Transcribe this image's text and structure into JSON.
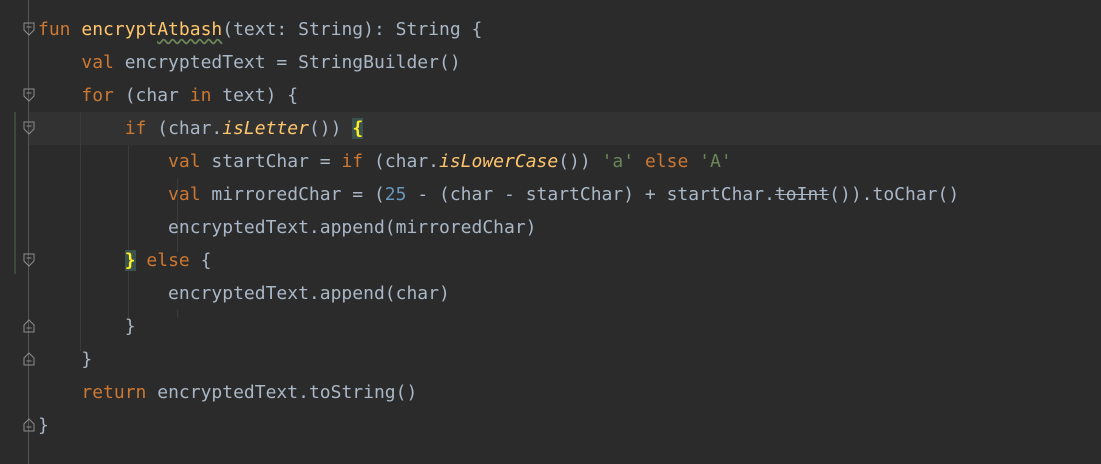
{
  "code": {
    "lines": [
      [
        {
          "t": "fun",
          "c": "kw"
        },
        {
          "t": " "
        },
        {
          "t": "encrypt",
          "c": "fn"
        },
        {
          "t": "Atbash",
          "c": "fn wavy"
        },
        {
          "t": "(text: String): String {"
        }
      ],
      [
        {
          "t": "    "
        },
        {
          "t": "val",
          "c": "kw"
        },
        {
          "t": " encryptedText = StringBuilder()"
        }
      ],
      [
        {
          "t": "    "
        },
        {
          "t": "for",
          "c": "kw"
        },
        {
          "t": " (char "
        },
        {
          "t": "in",
          "c": "kw"
        },
        {
          "t": " text) {"
        }
      ],
      [
        {
          "t": "        "
        },
        {
          "t": "if",
          "c": "kw"
        },
        {
          "t": " (char."
        },
        {
          "t": "isLetter",
          "c": "it"
        },
        {
          "t": "()) "
        },
        {
          "t": "{",
          "c": "brace-hl"
        }
      ],
      [
        {
          "t": "            "
        },
        {
          "t": "val",
          "c": "kw"
        },
        {
          "t": " startChar = "
        },
        {
          "t": "if",
          "c": "kw"
        },
        {
          "t": " (char."
        },
        {
          "t": "isLowerCase",
          "c": "it"
        },
        {
          "t": "()) "
        },
        {
          "t": "'a'",
          "c": "str"
        },
        {
          "t": " "
        },
        {
          "t": "else",
          "c": "kw"
        },
        {
          "t": " "
        },
        {
          "t": "'A'",
          "c": "str"
        }
      ],
      [
        {
          "t": "            "
        },
        {
          "t": "val",
          "c": "kw"
        },
        {
          "t": " mirroredChar = ("
        },
        {
          "t": "25",
          "c": "num"
        },
        {
          "t": " - (char - startChar) + startChar."
        },
        {
          "t": "toInt",
          "c": "strike"
        },
        {
          "t": "()).toChar()"
        }
      ],
      [
        {
          "t": "            encryptedText.append(mirroredChar)"
        }
      ],
      [
        {
          "t": "        "
        },
        {
          "t": "}",
          "c": "brace-hl"
        },
        {
          "t": " "
        },
        {
          "t": "else",
          "c": "kw"
        },
        {
          "t": " {"
        }
      ],
      [
        {
          "t": "            encryptedText.append(char)"
        }
      ],
      [
        {
          "t": "        }"
        }
      ],
      [
        {
          "t": "    }"
        }
      ],
      [
        {
          "t": "    "
        },
        {
          "t": "return",
          "c": "kw"
        },
        {
          "t": " encryptedText.toString()"
        }
      ],
      [
        {
          "t": "}"
        }
      ]
    ]
  },
  "fold_markers": [
    {
      "line": 0,
      "kind": "open"
    },
    {
      "line": 2,
      "kind": "open"
    },
    {
      "line": 3,
      "kind": "open"
    },
    {
      "line": 7,
      "kind": "open"
    },
    {
      "line": 9,
      "kind": "close"
    },
    {
      "line": 10,
      "kind": "close"
    },
    {
      "line": 12,
      "kind": "close"
    }
  ],
  "colors": {
    "background": "#2b2b2b",
    "current_line": "#323232",
    "default_text": "#a9b7c6",
    "keyword": "#cc7832",
    "function": "#ffc66d",
    "string": "#6a8759",
    "number": "#6897bb",
    "brace_highlight": "#3b514d",
    "brace_text": "#ffef28"
  }
}
